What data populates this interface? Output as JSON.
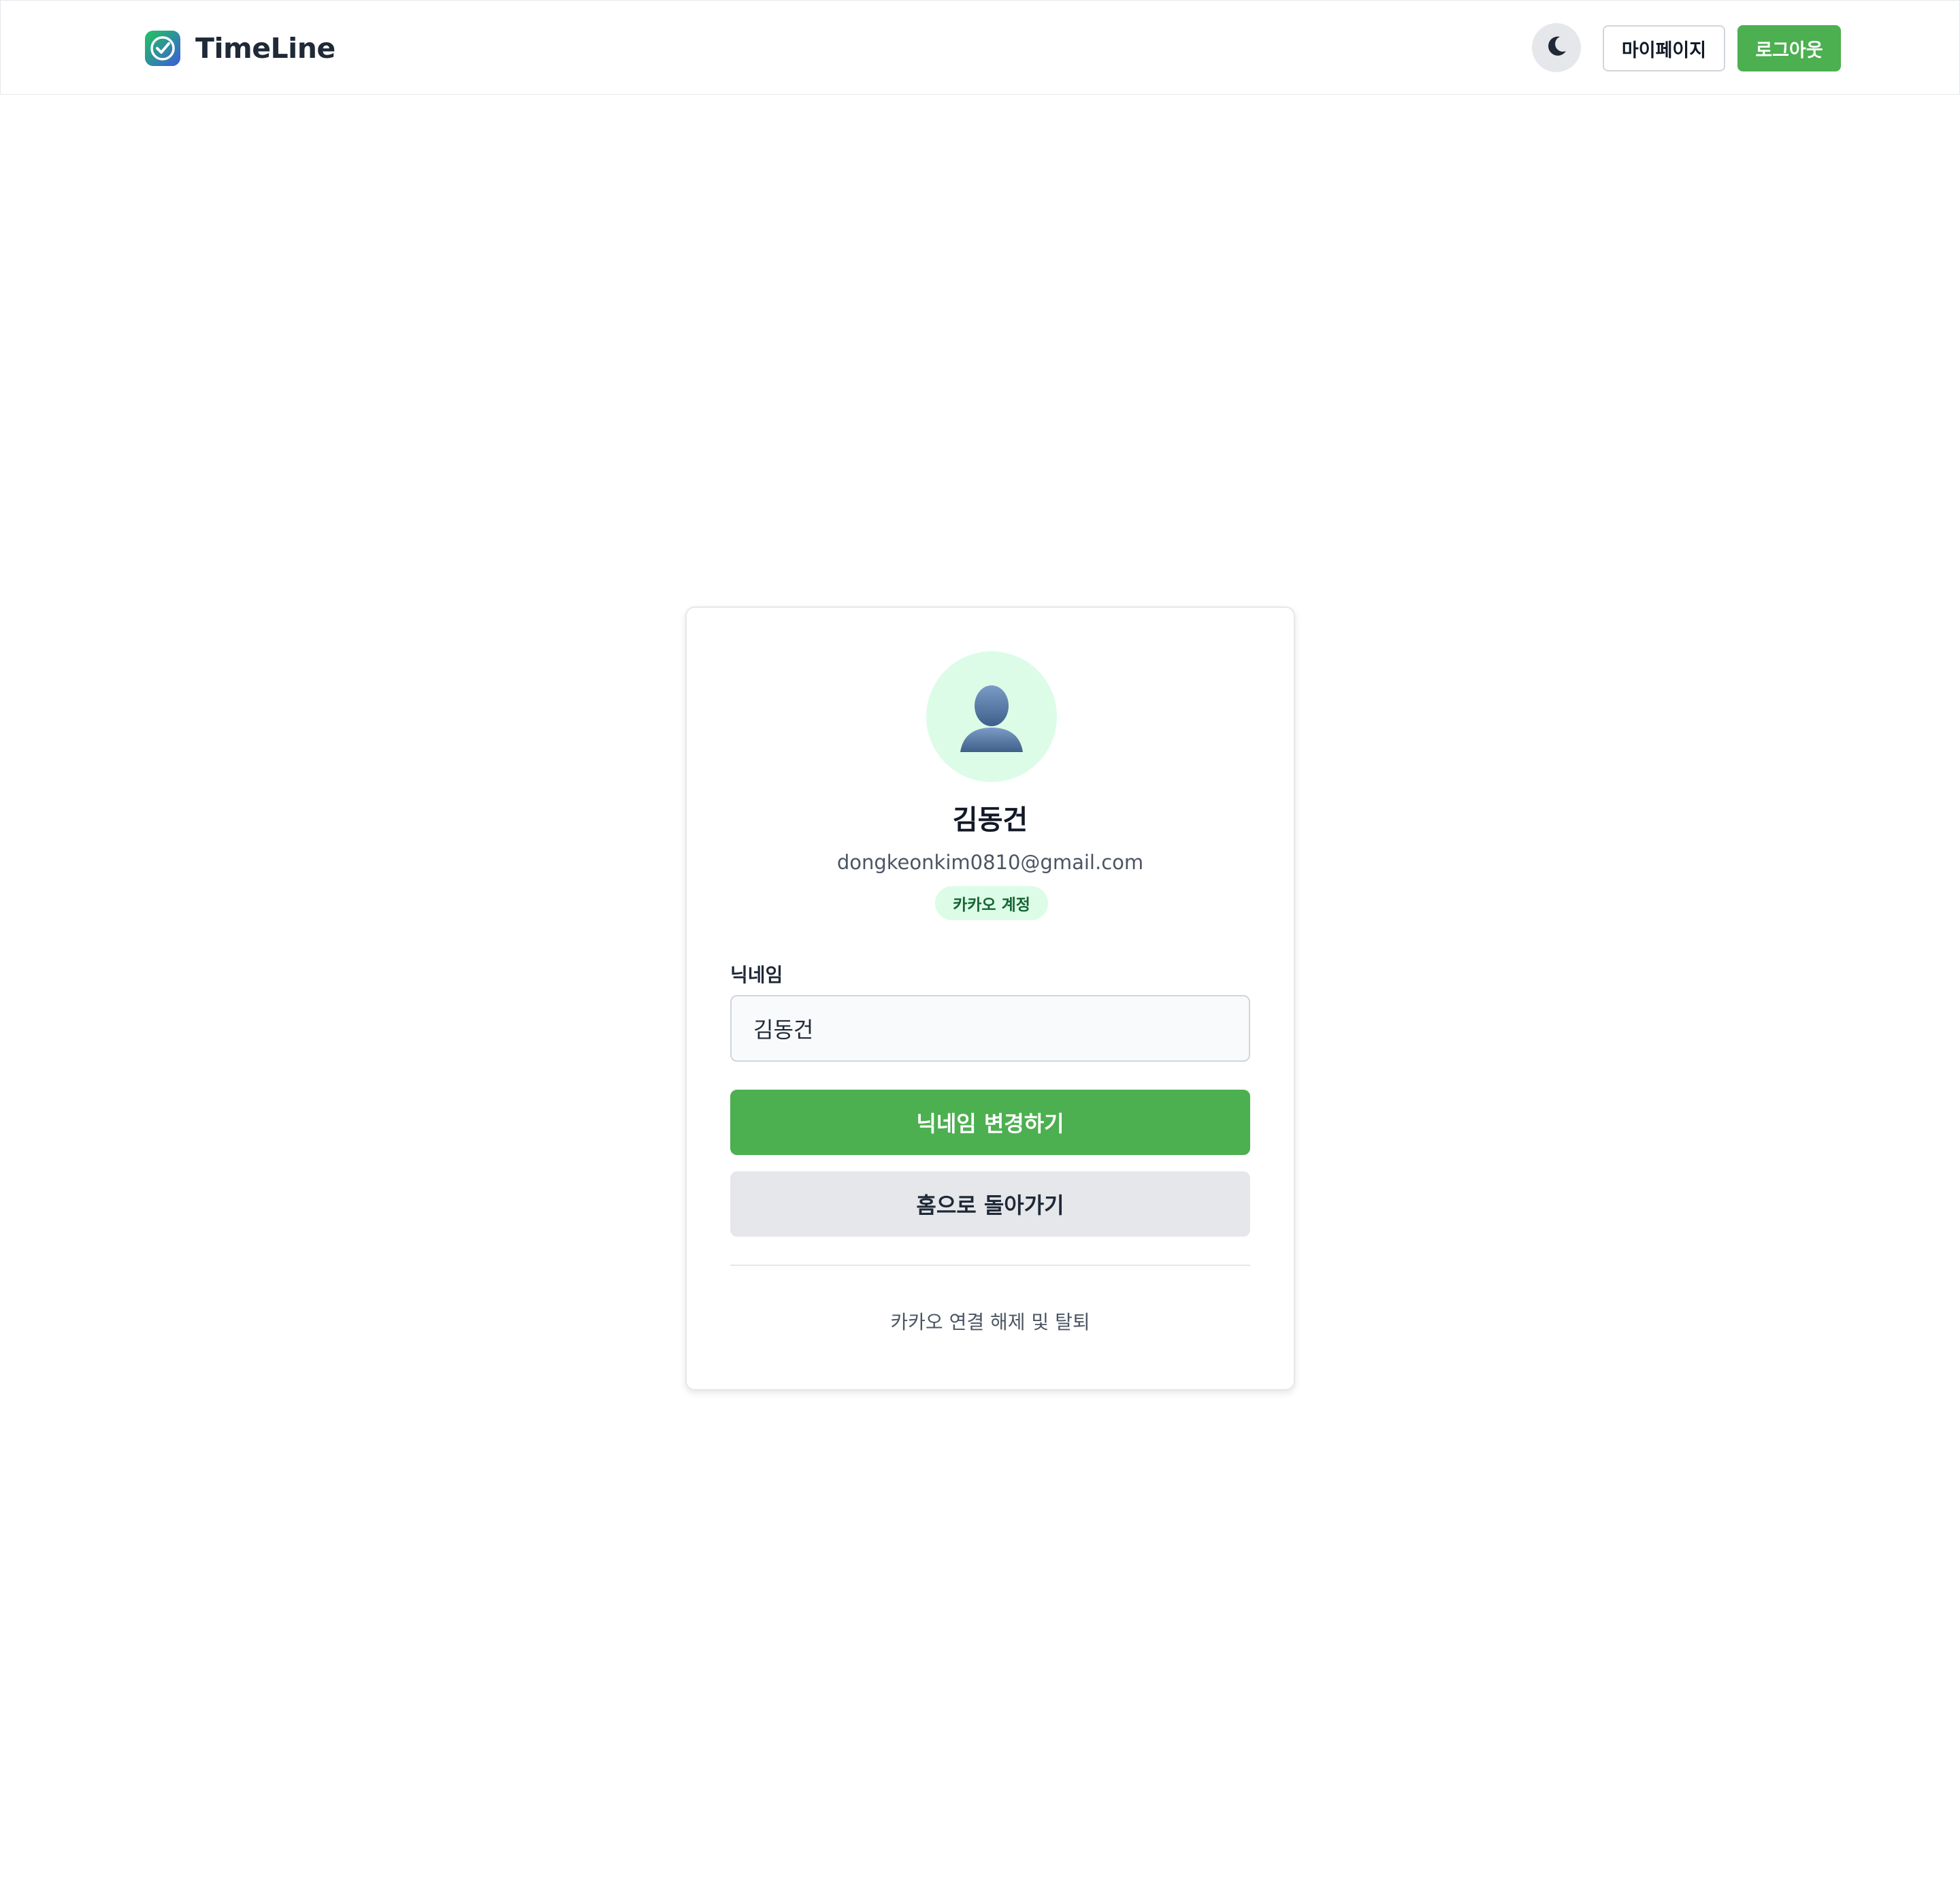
{
  "header": {
    "brand": "TimeLine",
    "logo_icon": "check-circle-icon",
    "theme_toggle_icon": "moon-icon",
    "mypage_label": "마이페이지",
    "logout_label": "로그아웃"
  },
  "profile": {
    "avatar_icon": "user-silhouette-icon",
    "name": "김동건",
    "email": "dongkeonkim0810@gmail.com",
    "account_badge": "카카오 계정"
  },
  "form": {
    "nickname_label": "닉네임",
    "nickname_value": "김동건",
    "change_button": "닉네임 변경하기",
    "home_button": "홈으로 돌아가기",
    "withdraw_link": "카카오 연결 해제 및 탈퇴"
  },
  "colors": {
    "accent_green": "#4caf50",
    "badge_bg": "#dcfce7",
    "badge_text": "#166534",
    "secondary_button_bg": "#e5e7eb"
  }
}
